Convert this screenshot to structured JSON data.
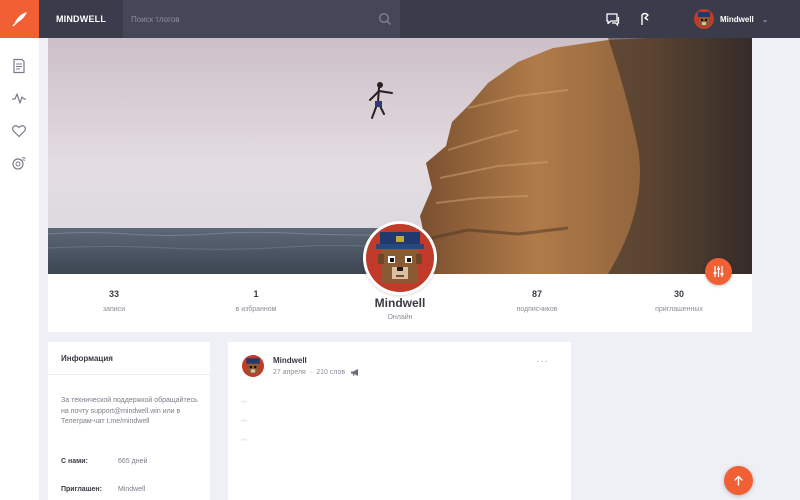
{
  "brand": "MINDWELL",
  "search": {
    "placeholder": "Поиск тлогов"
  },
  "topbar": {
    "icons": [
      "chat-icon",
      "notifications-icon"
    ],
    "user_name": "Mindwell",
    "caret": "⌄"
  },
  "sidebar": {
    "icons": [
      "feed-icon",
      "activity-icon",
      "favorites-icon",
      "friends-icon"
    ]
  },
  "profile": {
    "name": "Mindwell",
    "status": "Онлайн",
    "stats": [
      {
        "value": "33",
        "label": "записи"
      },
      {
        "value": "1",
        "label": "в избранном"
      },
      {
        "value": "87",
        "label": "подписчиков"
      },
      {
        "value": "30",
        "label": "приглашенных"
      }
    ]
  },
  "info": {
    "title": "Информация",
    "text": "За технической поддержкой обращайтесь на почту support@mindwell.win или в Телеграм-чат t.me/mindwell",
    "rows": [
      {
        "key": "С нами:",
        "value": "665 дней"
      },
      {
        "key": "Приглашен:",
        "value": "Mindwell"
      }
    ]
  },
  "post": {
    "author": "Mindwell",
    "date": "27 апреля",
    "separator": "·",
    "words": "210 слов",
    "more": "···",
    "paragraphs": [
      "...",
      "...",
      "..."
    ]
  },
  "colors": {
    "accent": "#f15f35",
    "topbar": "#3b3c4b",
    "search": "#454657",
    "background": "#eef0f6"
  }
}
